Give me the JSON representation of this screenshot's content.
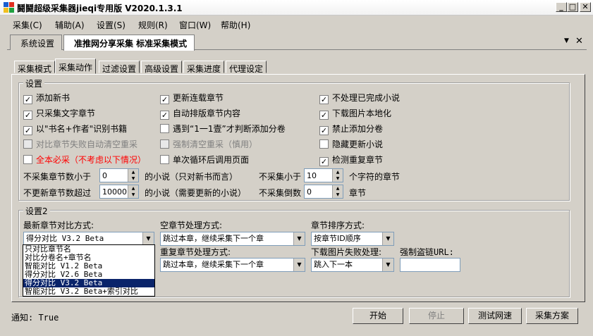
{
  "window": {
    "title": "鬪鬪超级采集器jieqi专用版 V2020.1.3.1",
    "minimize": "_",
    "maximize": "□",
    "close": "✕"
  },
  "menu": [
    "采集(C)",
    "辅助(A)",
    "设置(S)",
    "规则(R)",
    "窗口(W)",
    "帮助(H)"
  ],
  "doc_tabs": [
    "系统设置",
    "准推网分享采集 标准采集模式"
  ],
  "doc_tab_controls": {
    "dropdown": "▼",
    "close": "✕"
  },
  "inner_tabs": [
    "采集模式",
    "采集动作",
    "过滤设置",
    "高级设置",
    "采集进度",
    "代理设定"
  ],
  "settings1": {
    "title": "设置",
    "checkboxes": [
      {
        "label": "添加新书",
        "checked": true,
        "disabled": false,
        "red": false
      },
      {
        "label": "只采集文字章节",
        "checked": true,
        "disabled": false,
        "red": false
      },
      {
        "label": "以\"书名+作者\"识别书籍",
        "checked": true,
        "disabled": false,
        "red": false
      },
      {
        "label": "对比章节失败自动清空重采",
        "checked": false,
        "disabled": true,
        "red": false
      },
      {
        "label": "全本必采（不考虑以下情况）",
        "checked": false,
        "disabled": false,
        "red": true
      },
      {
        "label": "更新连载章节",
        "checked": true,
        "disabled": false,
        "red": false
      },
      {
        "label": "自动排版章节内容",
        "checked": true,
        "disabled": false,
        "red": false
      },
      {
        "label": "遇到“1一1壹”才判断添加分卷",
        "checked": false,
        "disabled": false,
        "red": false
      },
      {
        "label": "强制清空重采（慎用）",
        "checked": false,
        "disabled": true,
        "red": false
      },
      {
        "label": "单次循环后调用页面",
        "checked": false,
        "disabled": false,
        "red": false
      },
      {
        "label": "不处理已完成小说",
        "checked": true,
        "disabled": false,
        "red": false
      },
      {
        "label": "下载图片本地化",
        "checked": true,
        "disabled": false,
        "red": false
      },
      {
        "label": "禁止添加分卷",
        "checked": true,
        "disabled": false,
        "red": false
      },
      {
        "label": "隐藏更新小说",
        "checked": false,
        "disabled": false,
        "red": false
      },
      {
        "label": "检测重复章节",
        "checked": true,
        "disabled": false,
        "red": false
      }
    ],
    "row1": {
      "label_a": "不采集章节数小于",
      "value_a": "0",
      "label_b": "的小说（只对新书而言）",
      "label_c": "不采集小于",
      "value_c": "10",
      "label_d": "个字符的章节"
    },
    "row2": {
      "label_a": "不更新章节数超过",
      "value_a": "10000",
      "label_b": "的小说（需要更新的小说）",
      "label_c": "不采集倒数",
      "value_c": "0",
      "label_d": "章节"
    },
    "spin_up": "▲",
    "spin_down": "▼"
  },
  "settings2": {
    "title": "设置2",
    "compare_label": "最新章节对比方式:",
    "compare_value": "得分对比 V3.2 Beta",
    "compare_options": [
      "只对比章节名",
      "对比分卷名+章节名",
      "智能对比 V1.2 Beta",
      "得分对比 V2.6 Beta",
      "得分对比 V3.2 Beta",
      "智能对比 V3.2 Beta+索引对比"
    ],
    "compare_selected_index": 4,
    "empty_label": "空章节处理方式:",
    "empty_value": "跳过本章，继续采集下一个章",
    "order_label": "章节排序方式:",
    "order_value": "按章节ID顺序",
    "dup_label": "重复章节处理方式:",
    "dup_value": "跳过本章，继续采集下一个章",
    "imgfail_label": "下载图片失败处理:",
    "imgfail_value": "跳入下一本",
    "hotlink_label": "强制盗链URL:",
    "hotlink_value": "",
    "dropdown_arrow": "▼"
  },
  "status": "通知: True",
  "buttons": {
    "start": "开始",
    "stop": "停止",
    "test": "测试网速",
    "plan": "采集方案"
  },
  "colors": {
    "selection": "#0a246a",
    "red_text": "#ff0000",
    "disabled_text": "#808080"
  }
}
